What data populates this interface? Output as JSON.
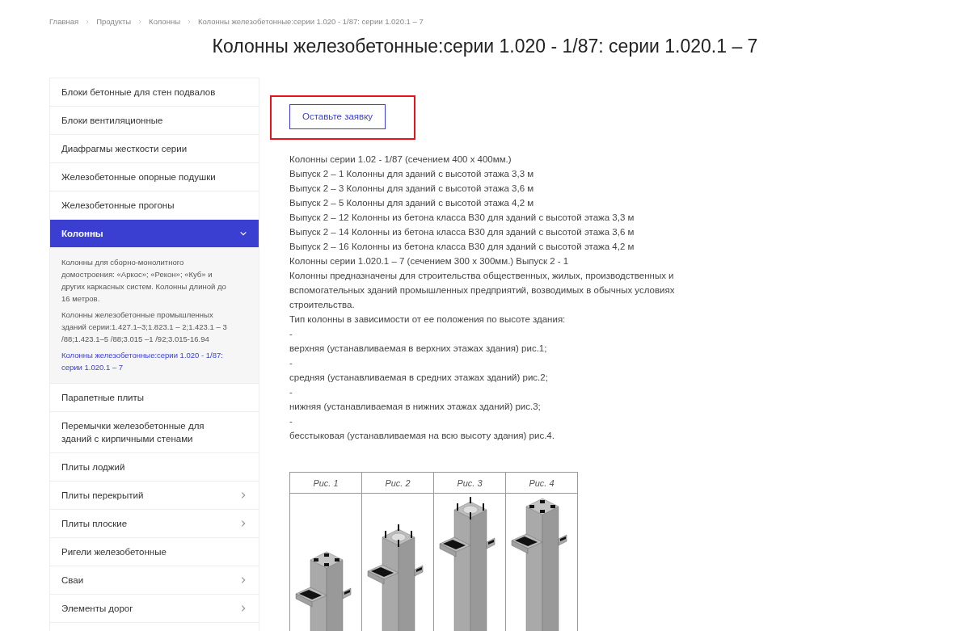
{
  "breadcrumbs": [
    "Главная",
    "Продукты",
    "Колонны",
    "Колонны железобетонные:серии 1.020 - 1/87: серии 1.020.1 – 7"
  ],
  "title": "Колонны железобетонные:серии 1.020 - 1/87: серии 1.020.1 – 7",
  "sidebar": {
    "items": [
      {
        "label": "Блоки бетонные для стен подвалов",
        "selected": false
      },
      {
        "label": "Блоки вентиляционные",
        "selected": false
      },
      {
        "label": "Диафрагмы жесткости серии",
        "selected": false
      },
      {
        "label": "Железобетонные опорные подушки",
        "selected": false
      },
      {
        "label": "Железобетонные прогоны",
        "selected": false
      },
      {
        "label": "Колонны",
        "selected": true,
        "expanded": true,
        "children": [
          {
            "label": "Колонны для сборно-монолитного домостроения: «Аркос»; «Рекон»; «Куб» и других каркасных систем. Колонны длиной до 16 метров.",
            "selected": false
          },
          {
            "label": "Колонны железобетонные промышленных зданий серии:1.427.1–3;1.823.1 – 2;1.423.1 – 3 /88;1.423.1–5 /88;3.015 –1 /92;3.015-16.94",
            "selected": false
          },
          {
            "label": "Колонны железобетонные:серии 1.020 - 1/87: серии 1.020.1 – 7",
            "selected": true
          }
        ]
      },
      {
        "label": "Парапетные плиты",
        "selected": false
      },
      {
        "label": "Перемычки железобетонные для зданий с кирпичными стенами",
        "selected": false
      },
      {
        "label": "Плиты лоджий",
        "selected": false
      },
      {
        "label": "Плиты перекрытий",
        "selected": false,
        "expanded": false
      },
      {
        "label": "Плиты плоские",
        "selected": false,
        "expanded": false
      },
      {
        "label": "Ригели железобетонные",
        "selected": false
      },
      {
        "label": "Сваи",
        "selected": false,
        "expanded": false
      },
      {
        "label": "Элементы дорог",
        "selected": false,
        "expanded": false
      }
    ]
  },
  "request_button": {
    "label": "Оставьте заявку",
    "highlighted": true
  },
  "description": [
    "Колонны серии 1.02 - 1/87 (сечением 400 х 400мм.)",
    "Выпуск 2 – 1 Колонны для зданий с высотой этажа 3,3 м",
    "Выпуск 2 – 3 Колонны для зданий с высотой этажа 3,6 м",
    "Выпуск 2 – 5 Колонны для зданий с высотой этажа 4,2 м",
    "Выпуск 2 – 12 Колонны из бетона класса В30 для зданий с высотой этажа 3,3 м",
    "Выпуск 2 – 14 Колонны из бетона класса В30 для зданий с высотой этажа 3,6 м",
    "Выпуск 2 – 16 Колонны из бетона класса В30 для зданий с высотой этажа 4,2 м",
    "Колонны серии 1.020.1 – 7 (сечением 300 х 300мм.) Выпуск 2 - 1",
    "Колонны предназначены для строительства общественных, жилых, производственных и вспомогательных зданий промышленных предприятий, возводимых в обычных условиях строительства.",
    "Тип колонны в зависимости от ее положения по высоте здания:",
    "-",
    "верхняя (устанавливаемая в верхних этажах здания) рис.1;",
    "-",
    "средняя (устанавливаемая в средних этажах зданий) рис.2;",
    "-",
    "нижняя (устанавливаемая в нижних этажах зданий) рис.3;",
    "-",
    "бесстыковая (устанавливаемая на всю высоту здания) рис.4."
  ],
  "figures": [
    {
      "caption": "Рис. 1",
      "kind": "plates"
    },
    {
      "caption": "Рис. 2",
      "kind": "rebar"
    },
    {
      "caption": "Рис. 3",
      "kind": "rebar"
    },
    {
      "caption": "Рис. 4",
      "kind": "plates"
    }
  ]
}
